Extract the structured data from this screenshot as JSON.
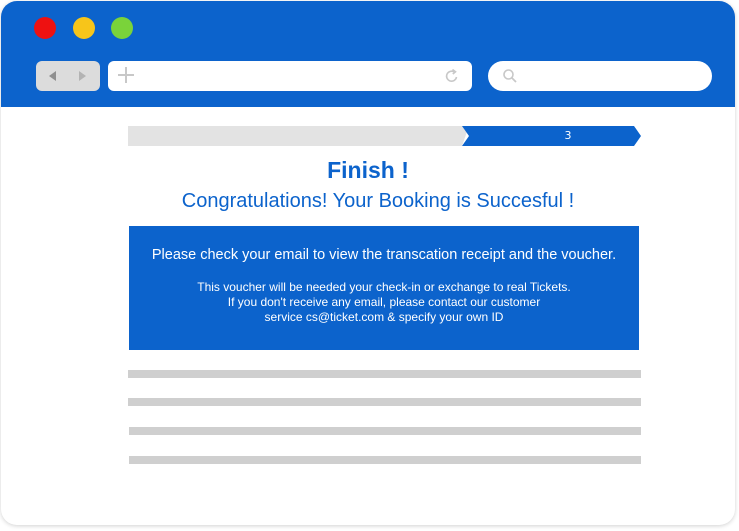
{
  "colors": {
    "titlebar": "#0c63cc",
    "accent": "#0c63cc",
    "progress_track": "#e3e3e3",
    "placeholder_line": "#cfcfcf",
    "window_buttons": [
      "#ee1111",
      "#f7c51a",
      "#7ad33a"
    ]
  },
  "browser": {
    "window_buttons": [
      "close-button",
      "minimize-button",
      "maximize-button"
    ],
    "address": {
      "value": "",
      "icons": [
        "plus-icon",
        "reload-icon"
      ]
    },
    "search": {
      "value": "",
      "icon": "search-icon"
    },
    "nav_icons": [
      "back-arrow-icon",
      "forward-arrow-icon"
    ]
  },
  "progress": {
    "current_step_label": "3"
  },
  "content": {
    "title": "Finish !",
    "subtitle": "Congratulations! Your Booking is Succesful !",
    "notice_main": "Please check your email to view the transcation receipt and the voucher.",
    "notice_lines": [
      "This voucher will be needed your check-in or exchange to real Tickets.",
      "If you don't receive any email, please contact our customer",
      "service cs@ticket.com & specify your own ID"
    ]
  }
}
